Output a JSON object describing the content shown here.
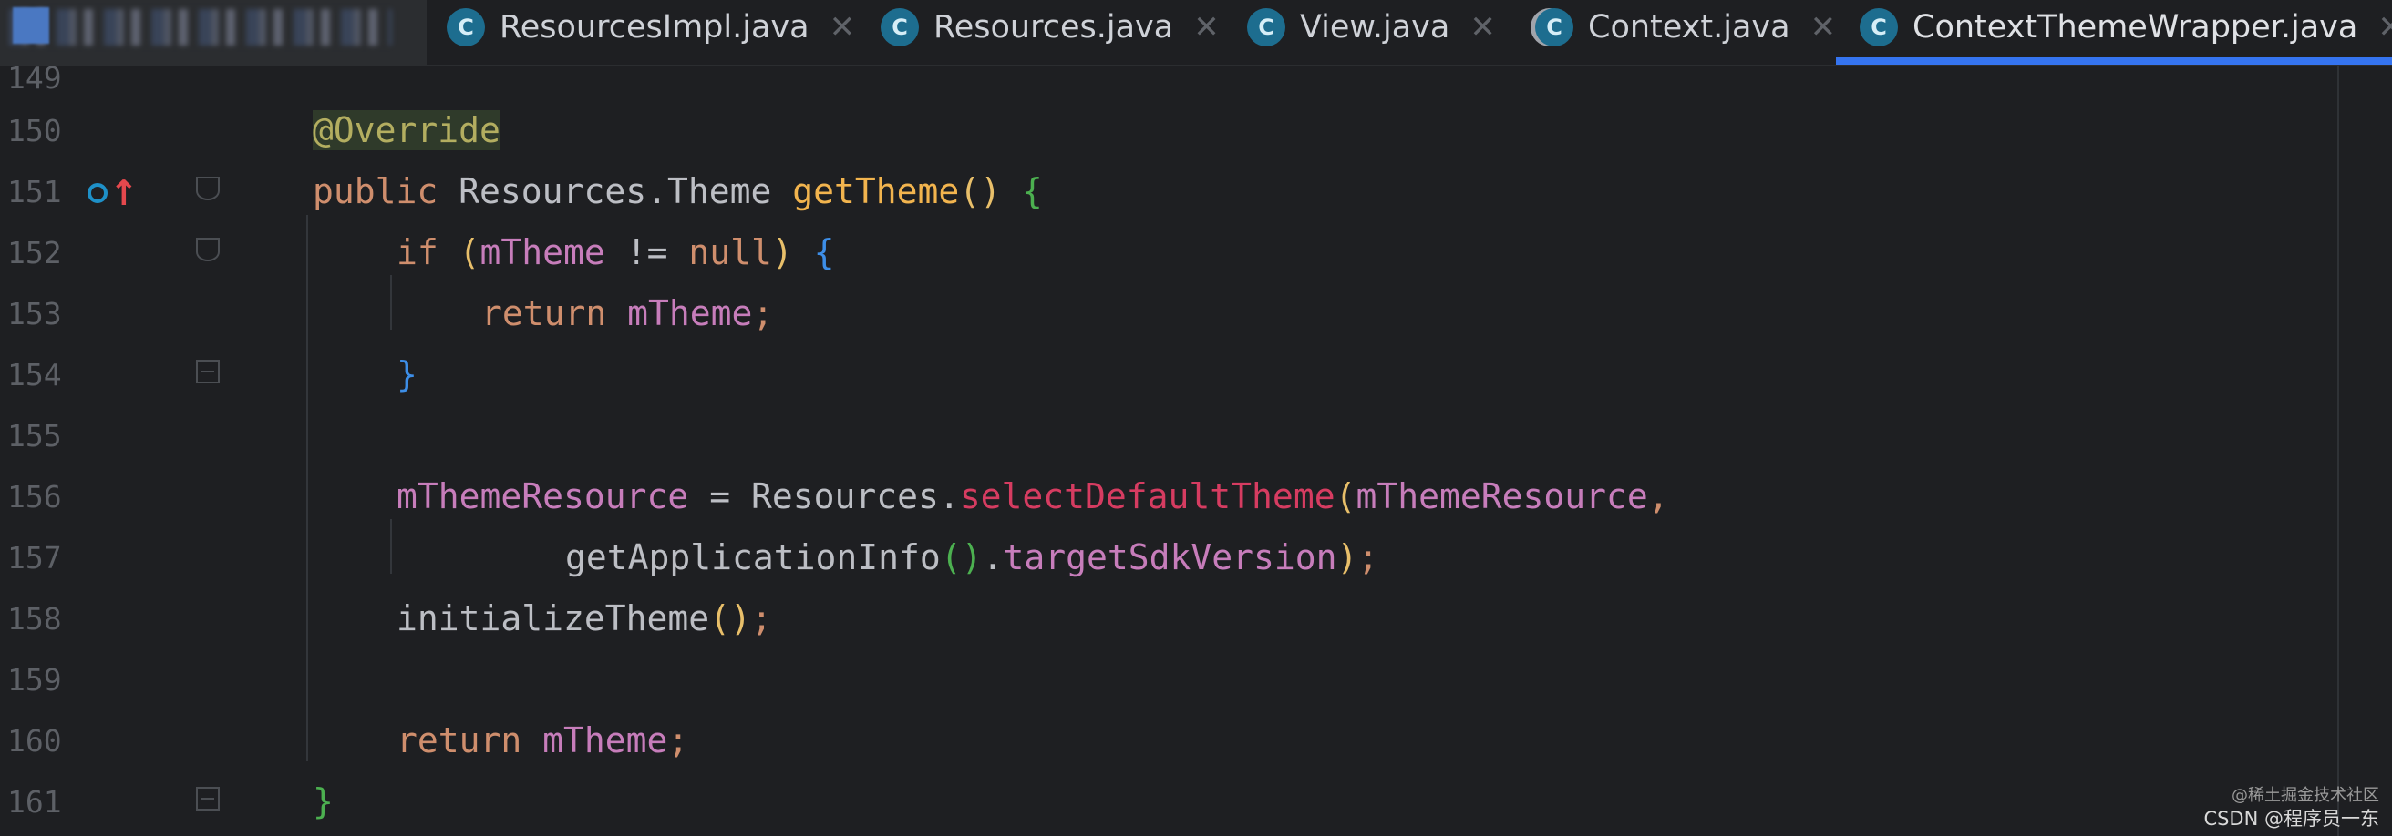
{
  "tabs": [
    {
      "label": "ResourcesImpl.java",
      "icon": "class-icon",
      "active": false
    },
    {
      "label": "Resources.java",
      "icon": "class-icon",
      "active": false
    },
    {
      "label": "View.java",
      "icon": "class-icon",
      "active": false
    },
    {
      "label": "Context.java",
      "icon": "class-icon",
      "active": false
    },
    {
      "label": "ContextThemeWrapper.java",
      "icon": "class-icon",
      "active": true
    }
  ],
  "tab_icon_letter": "C",
  "close_glyph": "✕",
  "line_numbers": [
    "149",
    "150",
    "151",
    "152",
    "153",
    "154",
    "155",
    "156",
    "157",
    "158",
    "159",
    "160",
    "161"
  ],
  "code": {
    "l150": {
      "annotation": "@Override"
    },
    "l151": {
      "kw": "public",
      "type": "Resources.Theme",
      "fn": "getTheme",
      "parens": "()",
      "brace": "{"
    },
    "l152": {
      "kw": "if",
      "open": "(",
      "field": "mTheme",
      "op": "!=",
      "null": "null",
      "close": ")",
      "brace": "{"
    },
    "l153": {
      "kw": "return",
      "field": "mTheme",
      "semi": ";"
    },
    "l154": {
      "brace": "}"
    },
    "l156": {
      "field": "mThemeResource",
      "eq": "=",
      "cls": "Resources",
      "dot": ".",
      "static": "selectDefaultTheme",
      "open": "(",
      "arg": "mThemeResource",
      "comma": ","
    },
    "l157": {
      "fn": "getApplicationInfo",
      "parens": "()",
      "dot": ".",
      "field": "targetSdkVersion",
      "close": ")",
      "semi": ";"
    },
    "l158": {
      "fn": "initializeTheme",
      "parens": "()",
      "semi": ";"
    },
    "l160": {
      "kw": "return",
      "field": "mTheme",
      "semi": ";"
    },
    "l161": {
      "brace": "}"
    }
  },
  "watermark": {
    "line1": "@稀土掘金技术社区",
    "line2": "CSDN @程序员一东"
  },
  "colors": {
    "background": "#1e1f22",
    "keyword": "#cf8e6d",
    "function": "#f2b44e",
    "field": "#c77dbb",
    "static_method": "#d63c61",
    "annotation": "#b3ae60",
    "active_tab_underline": "#3574f0"
  }
}
